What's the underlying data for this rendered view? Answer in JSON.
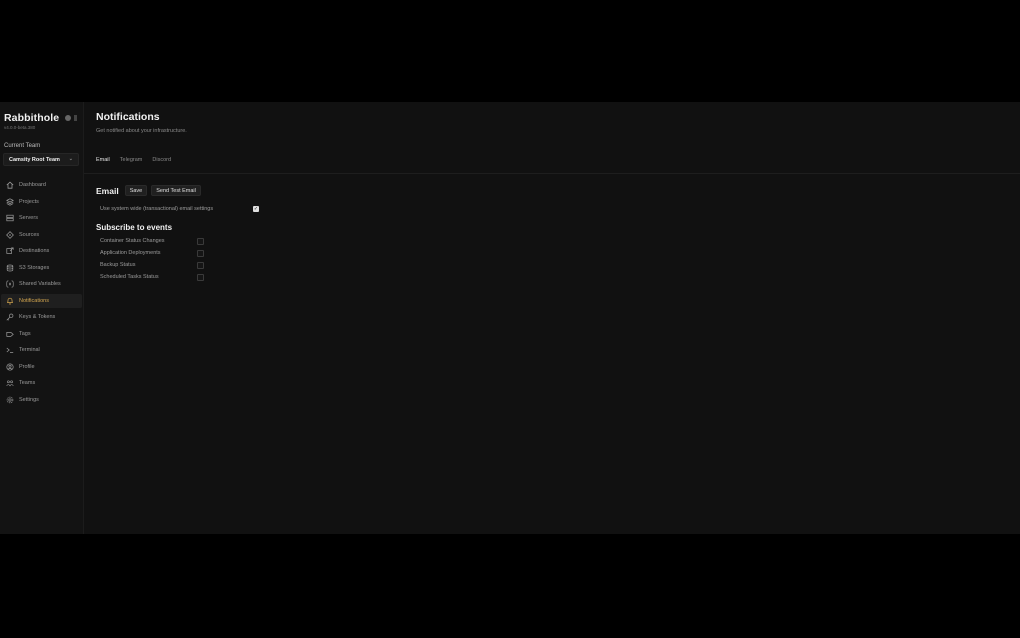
{
  "app": {
    "brand": "Rabbithole",
    "version": "v4.0.0-beta.380",
    "team_label": "Current Team",
    "team_selected": "Camsity Root Team"
  },
  "sidebar": {
    "items": [
      {
        "label": "Dashboard",
        "icon": "home-icon",
        "active": false
      },
      {
        "label": "Projects",
        "icon": "projects-icon",
        "active": false
      },
      {
        "label": "Servers",
        "icon": "server-icon",
        "active": false
      },
      {
        "label": "Sources",
        "icon": "git-icon",
        "active": false
      },
      {
        "label": "Destinations",
        "icon": "destination-icon",
        "active": false
      },
      {
        "label": "S3 Storages",
        "icon": "storage-icon",
        "active": false
      },
      {
        "label": "Shared Variables",
        "icon": "variables-icon",
        "active": false
      },
      {
        "label": "Notifications",
        "icon": "bell-icon",
        "active": true
      },
      {
        "label": "Keys & Tokens",
        "icon": "key-icon",
        "active": false
      },
      {
        "label": "Tags",
        "icon": "tag-icon",
        "active": false
      },
      {
        "label": "Terminal",
        "icon": "terminal-icon",
        "active": false
      },
      {
        "label": "Profile",
        "icon": "profile-icon",
        "active": false
      },
      {
        "label": "Teams",
        "icon": "teams-icon",
        "active": false
      },
      {
        "label": "Settings",
        "icon": "gear-icon",
        "active": false
      }
    ]
  },
  "page": {
    "title": "Notifications",
    "subtitle": "Get notified about your infrastructure.",
    "tabs": [
      {
        "label": "Email",
        "active": true
      },
      {
        "label": "Telegram",
        "active": false
      },
      {
        "label": "Discord",
        "active": false
      }
    ]
  },
  "email": {
    "title": "Email",
    "save_label": "Save",
    "test_label": "Send Test Email",
    "system_wide_label": "Use system wide (transactional) email settings",
    "system_wide_checked": true
  },
  "events": {
    "title": "Subscribe to events",
    "items": [
      {
        "label": "Container Status Changes",
        "checked": false
      },
      {
        "label": "Application Deployments",
        "checked": false
      },
      {
        "label": "Backup Status",
        "checked": false
      },
      {
        "label": "Scheduled Tasks Status",
        "checked": false
      }
    ]
  },
  "colors": {
    "background": "#111111",
    "active_accent": "#d6a850"
  }
}
